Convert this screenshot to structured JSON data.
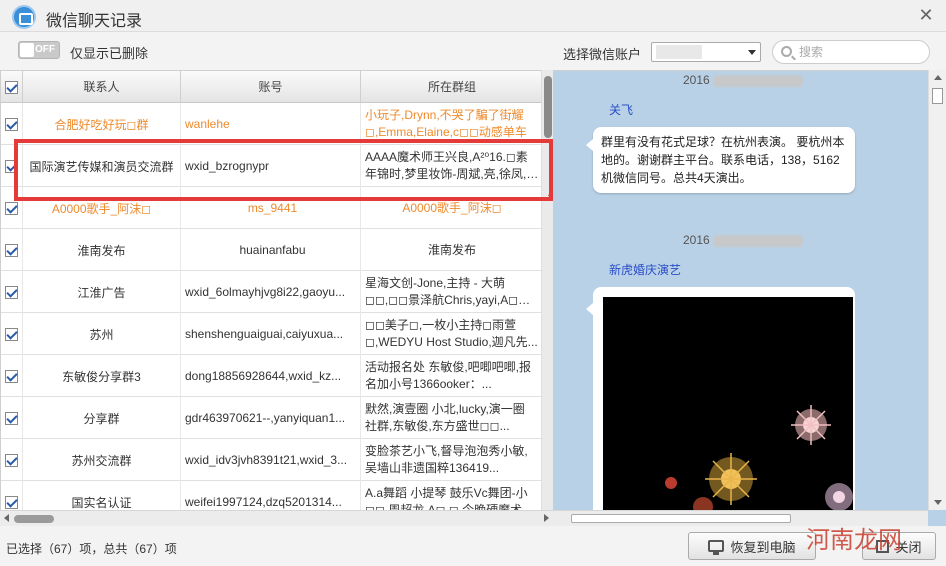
{
  "window": {
    "title": "微信聊天记录",
    "close_glyph": "✕"
  },
  "toolbar": {
    "toggle_text": "OFF",
    "toggle_label": "仅显示已删除",
    "account_label": "选择微信账户",
    "account_value": "",
    "search_placeholder": "搜索"
  },
  "table": {
    "headers": [
      "联系人",
      "账号",
      "所在群组"
    ],
    "rows": [
      {
        "contact": "合肥好吃好玩◻群",
        "account": "wanlehe",
        "groups": "小玩子,Drynn,不哭了騙了街耀◻,Emma,Elaine,c◻◻动感单车",
        "style": "orange"
      },
      {
        "contact": "国际演艺传媒和演员交流群",
        "account": "wxid_bzrognypr",
        "groups": "AAAA魔术师王兴良,A²⁰16.◻素年锦时,梦里妆饰-周斌,亮,徐凤,淡...",
        "style": "dark"
      },
      {
        "contact": "A0000歌手_阿沫◻",
        "account": "ms_9441",
        "groups": "A0000歌手_阿沫◻",
        "style": "orange"
      },
      {
        "contact": "淮南发布",
        "account": "huainanfabu",
        "groups": "淮南发布",
        "style": "dark"
      },
      {
        "contact": "江淮广告",
        "account": "wxid_6olmayhjvg8i22,gaoyu...",
        "groups": "星海文创-Jone,主持 - 大萌◻◻,◻◻景泽航Chris,yayi,A◻象头神◻◻...",
        "style": "dark"
      },
      {
        "contact": "苏州",
        "account": "shenshenguaiguai,caiyuxua...",
        "groups": "◻◻美子◻,一枚小主持◻雨萱◻,WEDYU Host Studio,迦凡先...",
        "style": "dark"
      },
      {
        "contact": "东敏俊分享群3",
        "account": "dong18856928644,wxid_kz...",
        "groups": "活动报名处 东敏俊,吧唧吧唧,报名加小号1366ooker：...",
        "style": "dark"
      },
      {
        "contact": "分享群",
        "account": "gdr463970621--,yanyiquan1...",
        "groups": "默然,演壹圈 小北,lucky,演一圈 社群,东敏俊,东方盛世◻◻...",
        "style": "dark"
      },
      {
        "contact": "苏州交流群",
        "account": "wxid_idv3jvh8391t21,wxid_3...",
        "groups": "变脸茶艺小飞,督导泡泡秀小敏,吴墙山非遗国粹136419...",
        "style": "dark"
      },
      {
        "contact": "国实名认证",
        "account": "weifei1997124,dzq5201314...",
        "groups": "A.a舞蹈 小提琴 鼓乐Vc舞团-小◻◻,周超龙 A◻ ◻,今晚硬魔术...",
        "style": "dark"
      }
    ]
  },
  "chat": {
    "messages": [
      {
        "date": "2016",
        "sender": "关飞",
        "text": "群里有没有花式足球？在杭州表演。 要杭州本地的。谢谢群主平台。联系电话，138，5162机微信同号。总共4天演出。"
      },
      {
        "date": "2016",
        "sender": "新虎婚庆演艺",
        "text": ""
      }
    ]
  },
  "status": {
    "text": "已选择（67）项，总共（67）项",
    "restore_label": "恢复到电脑",
    "close_label": "关闭"
  },
  "watermark": "河南龙网",
  "colors": {
    "accent_orange": "#ee8a2c",
    "highlight_red": "#e53a3a",
    "chat_bg": "#b9d1e6",
    "sender_blue": "#2a4ec8"
  }
}
